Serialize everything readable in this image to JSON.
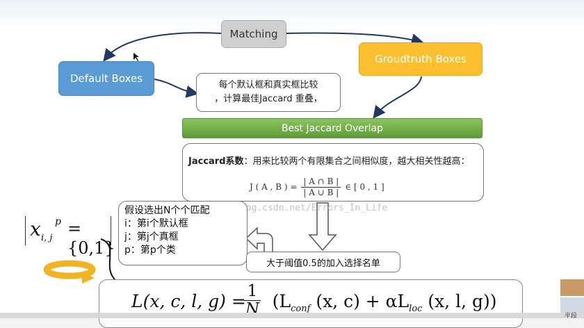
{
  "nodes": {
    "matching": "Matching",
    "default_boxes": "Default Boxes",
    "groundtruth_boxes": "Groudtruth Boxes",
    "note_line1": "每个默认框和真实框比较",
    "note_line2": "，计算最佳Jaccard 重叠，",
    "best_overlap": "Best Jaccard Overlap",
    "jaccard_title": "Jaccard系数",
    "jaccard_desc": "：用来比较两个有限集合之间相似度，越大相关性越高：",
    "jaccard_lhs": "J ( A , B ) =",
    "jaccard_num": "| A ∩ B |",
    "jaccard_den": "| A ∪ B |",
    "jaccard_rhs": "∈ [ 0 , 1 ]",
    "watermark": "log.csdn.net/Errors_In_Life",
    "assume_line1": "假设选出N个个匹配",
    "assume_line2": "i：第i个默认框",
    "assume_line3": "j：第j个真框",
    "assume_line4": "p：第p个类",
    "threshold": "大于阈值0.5的加入选择名单",
    "xij_x": "x",
    "xij_sub": "i, j",
    "xij_sup": "p",
    "xij_rhs": "= {0,1}",
    "loss_lhs": "L(x, c, l, g) = ",
    "loss_one": "1",
    "loss_n": "N",
    "loss_rhs_a": "(L",
    "loss_conf": "conf",
    "loss_rhs_b": " (x, c) + αL",
    "loss_loc": "loc",
    "loss_rhs_c": " (x, l, g))",
    "corner_label": "半段"
  },
  "colors": {
    "matching_fill": "#cfcfcf",
    "default_fill": "#5b9bd5",
    "ground_fill": "#fcc02e",
    "best_fill": "#70ad47",
    "arrow_navy": "#1f3864",
    "ring_gold": "#f0b323"
  }
}
